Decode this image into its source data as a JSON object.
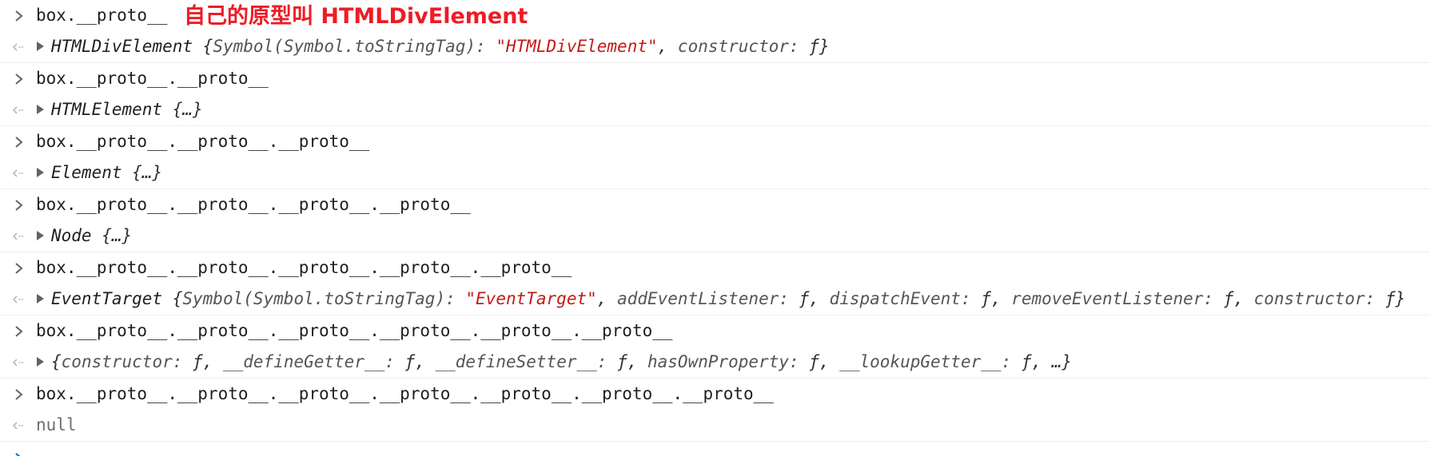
{
  "annotation": "自己的原型叫 HTMLDivElement",
  "entries": [
    {
      "input": "box.__proto__",
      "output_type": "HTMLDivElement",
      "output_parts": [
        {
          "cls": "punct",
          "text": " {"
        },
        {
          "cls": "key",
          "text": "Symbol(Symbol.toStringTag): "
        },
        {
          "cls": "str",
          "text": "\"HTMLDivElement\""
        },
        {
          "cls": "punct",
          "text": ", "
        },
        {
          "cls": "key",
          "text": "constructor: "
        },
        {
          "cls": "punct",
          "text": "ƒ}"
        }
      ]
    },
    {
      "input": "box.__proto__.__proto__",
      "output_type": "HTMLElement",
      "output_parts": [
        {
          "cls": "punct",
          "text": " {…}"
        }
      ]
    },
    {
      "input": "box.__proto__.__proto__.__proto__",
      "output_type": "Element",
      "output_parts": [
        {
          "cls": "punct",
          "text": " {…}"
        }
      ]
    },
    {
      "input": "box.__proto__.__proto__.__proto__.__proto__",
      "output_type": "Node",
      "output_parts": [
        {
          "cls": "punct",
          "text": " {…}"
        }
      ]
    },
    {
      "input": "box.__proto__.__proto__.__proto__.__proto__.__proto__",
      "output_type": "EventTarget",
      "output_parts": [
        {
          "cls": "punct",
          "text": " {"
        },
        {
          "cls": "key",
          "text": "Symbol(Symbol.toStringTag): "
        },
        {
          "cls": "str",
          "text": "\"EventTarget\""
        },
        {
          "cls": "punct",
          "text": ", "
        },
        {
          "cls": "key",
          "text": "addEventListener: "
        },
        {
          "cls": "punct",
          "text": "ƒ, "
        },
        {
          "cls": "key",
          "text": "dispatchEvent: "
        },
        {
          "cls": "punct",
          "text": "ƒ, "
        },
        {
          "cls": "key",
          "text": "removeEventListener: "
        },
        {
          "cls": "punct",
          "text": "ƒ, "
        },
        {
          "cls": "key",
          "text": "constructor: "
        },
        {
          "cls": "punct",
          "text": "ƒ}"
        }
      ]
    },
    {
      "input": "box.__proto__.__proto__.__proto__.__proto__.__proto__.__proto__",
      "output_type": "",
      "output_parts": [
        {
          "cls": "punct",
          "text": "{"
        },
        {
          "cls": "key",
          "text": "constructor: "
        },
        {
          "cls": "punct",
          "text": "ƒ, "
        },
        {
          "cls": "key",
          "text": "__defineGetter__: "
        },
        {
          "cls": "punct",
          "text": "ƒ, "
        },
        {
          "cls": "key",
          "text": "__defineSetter__: "
        },
        {
          "cls": "punct",
          "text": "ƒ, "
        },
        {
          "cls": "key",
          "text": "hasOwnProperty: "
        },
        {
          "cls": "punct",
          "text": "ƒ, "
        },
        {
          "cls": "key",
          "text": "__lookupGetter__: "
        },
        {
          "cls": "punct",
          "text": "ƒ, …}"
        }
      ]
    },
    {
      "input": "box.__proto__.__proto__.__proto__.__proto__.__proto__.__proto__.__proto__",
      "null_output": "null"
    }
  ],
  "icons": {
    "input_prompt": "chevron-right-icon",
    "result_arrow": "result-arrow-icon",
    "expand": "expand-triangle-icon",
    "active_prompt": "active-prompt-chevron-icon"
  },
  "colors": {
    "prompt": "#5f6368",
    "active_prompt": "#1a73e8",
    "string": "#c41a16",
    "annotation": "#ee1c25",
    "divider": "#eeeeee"
  }
}
